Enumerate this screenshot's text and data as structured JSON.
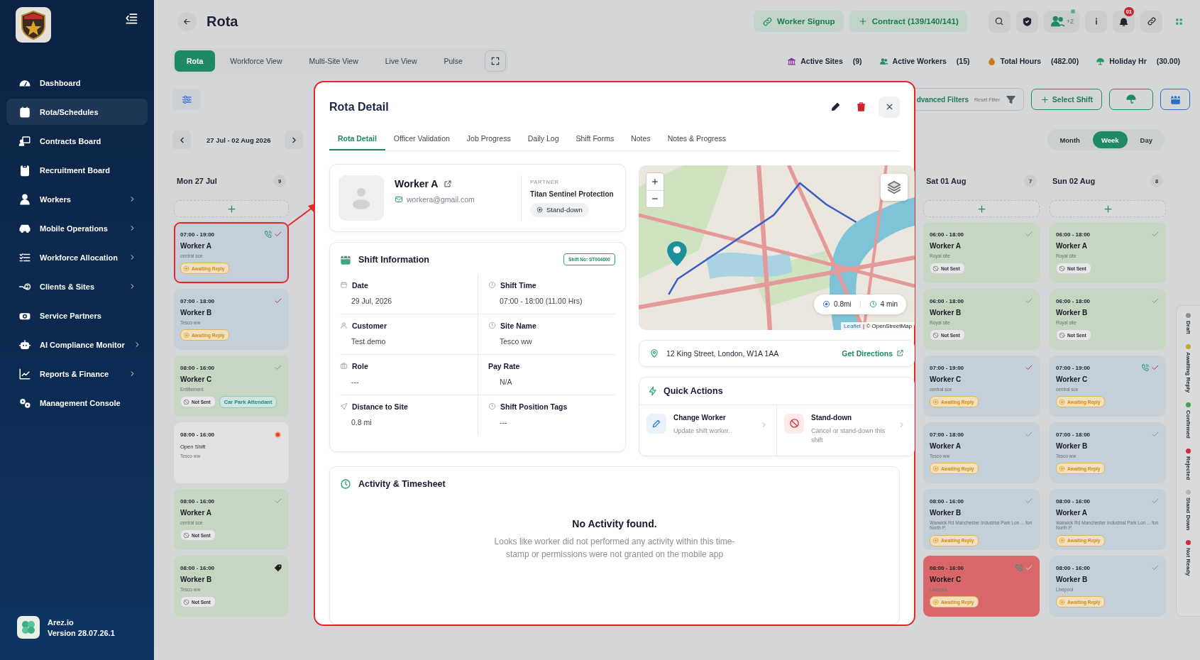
{
  "sidebar": {
    "items": [
      {
        "label": "Dashboard",
        "has_submenu": false,
        "selected": false
      },
      {
        "label": "Rota/Schedules",
        "has_submenu": false,
        "selected": true
      },
      {
        "label": "Contracts Board",
        "has_submenu": false,
        "selected": false
      },
      {
        "label": "Recruitment Board",
        "has_submenu": false,
        "selected": false
      },
      {
        "label": "Workers",
        "has_submenu": true,
        "selected": false
      },
      {
        "label": "Mobile Operations",
        "has_submenu": true,
        "selected": false
      },
      {
        "label": "Workforce Allocation",
        "has_submenu": true,
        "selected": false
      },
      {
        "label": "Clients & Sites",
        "has_submenu": true,
        "selected": false
      },
      {
        "label": "Service Partners",
        "has_submenu": false,
        "selected": false
      },
      {
        "label": "AI Compliance Monitor",
        "has_submenu": true,
        "selected": false
      },
      {
        "label": "Reports & Finance",
        "has_submenu": true,
        "selected": false
      },
      {
        "label": "Management Console",
        "has_submenu": false,
        "selected": false
      }
    ],
    "footer": {
      "name": "Arez.io",
      "version": "Version 28.07.26.1"
    }
  },
  "header": {
    "title": "Rota",
    "actions": [
      {
        "label": "Worker Signup"
      },
      {
        "label": "Contract (139/140/141)"
      }
    ],
    "avatar_more": "+2",
    "notification_count": "01"
  },
  "view_tabs": [
    {
      "label": "Rota",
      "selected": true
    },
    {
      "label": "Workforce View",
      "selected": false
    },
    {
      "label": "Multi-Site View",
      "selected": false
    },
    {
      "label": "Live View",
      "selected": false
    },
    {
      "label": "Pulse",
      "selected": false
    }
  ],
  "stats": [
    {
      "label": "Active Sites",
      "value": "(9)"
    },
    {
      "label": "Active Workers",
      "value": "(15)"
    },
    {
      "label": "Total Hours",
      "value": "(482.00)"
    },
    {
      "label": "Holiday Hr",
      "value": "(30.00)"
    }
  ],
  "filters": {
    "advanced": "dvanced Filters",
    "reset": "Reset Filter",
    "select_shift": "Select Shift"
  },
  "date_range": "27 Jul - 02 Aug 2026",
  "period_tabs": [
    {
      "label": "Month",
      "selected": false
    },
    {
      "label": "Week",
      "selected": true
    },
    {
      "label": "Day",
      "selected": false
    }
  ],
  "days": [
    {
      "title": "Mon 27 Jul",
      "count": "9",
      "shifts": [
        {
          "kind": "assigned",
          "time": "07:00 - 19:00",
          "worker": "Worker A",
          "site": "central sce",
          "status": {
            "kind": "awaiting",
            "label": "Awaiting Reply"
          },
          "color": "#c3cfd9",
          "marker": {
            "kind": "check",
            "color": "#d6285a"
          },
          "phone": true,
          "highlighted": true
        },
        {
          "kind": "assigned",
          "time": "07:00 - 18:00",
          "worker": "Worker B",
          "site": "Tesco ww",
          "status": {
            "kind": "awaiting",
            "label": "Awaiting Reply"
          },
          "color": "#c3cfd9",
          "marker": {
            "kind": "check",
            "color": "#d6285a"
          },
          "phone": false,
          "highlighted": false
        },
        {
          "kind": "assigned",
          "time": "08:00 - 16:00",
          "worker": "Worker C",
          "site": "Entitlement",
          "status": {
            "kind": "not_sent",
            "label": "Not Sent"
          },
          "tag": "Car Park Attendant",
          "color": "#c7d6c3",
          "marker": {
            "kind": "check",
            "color": "#8c9490"
          },
          "phone": false,
          "highlighted": false
        },
        {
          "kind": "open",
          "time": "08:00 - 16:00",
          "worker": "Open Shift",
          "site": "Tesco ww",
          "color": "#e2e2e2",
          "marker": {
            "kind": "dot",
            "color": "#e0452a"
          },
          "phone": false,
          "highlighted": false
        },
        {
          "kind": "assigned",
          "time": "08:00 - 16:00",
          "worker": "Worker A",
          "site": "central sce",
          "status": {
            "kind": "not_sent",
            "label": "Not Sent"
          },
          "color": "#c7d6c3",
          "marker": {
            "kind": "check",
            "color": "#8c9490"
          },
          "phone": false,
          "highlighted": false
        },
        {
          "kind": "assigned",
          "time": "08:00 - 16:00",
          "worker": "Worker B",
          "site": "Tesco ww",
          "status": {
            "kind": "not_sent",
            "label": "Not Sent"
          },
          "color": "#c7d6c3",
          "marker": {
            "kind": "tag",
            "color": "#1c1c1c"
          },
          "phone": false,
          "highlighted": false
        }
      ]
    },
    {
      "title": "Sat 01 Aug",
      "count": "7",
      "shifts": [
        {
          "kind": "assigned",
          "time": "06:00 - 18:00",
          "worker": "Worker A",
          "site": "Royal site",
          "status": {
            "kind": "not_sent",
            "label": "Not Sent"
          },
          "color": "#c7d6c3",
          "marker": {
            "kind": "check",
            "color": "#8c9490"
          },
          "phone": false,
          "highlighted": false
        },
        {
          "kind": "assigned",
          "time": "06:00 - 18:00",
          "worker": "Worker B",
          "site": "Royal site",
          "status": {
            "kind": "not_sent",
            "label": "Not Sent"
          },
          "color": "#c7d6c3",
          "marker": {
            "kind": "check",
            "color": "#8c9490"
          },
          "phone": false,
          "highlighted": false
        },
        {
          "kind": "assigned",
          "time": "07:00 - 19:00",
          "worker": "Worker C",
          "site": "central sce",
          "status": {
            "kind": "awaiting",
            "label": "Awaiting Reply"
          },
          "color": "#c3cfd9",
          "marker": {
            "kind": "check",
            "color": "#d6285a"
          },
          "phone": false,
          "highlighted": false
        },
        {
          "kind": "assigned",
          "time": "07:00 - 18:00",
          "worker": "Worker A",
          "site": "Tesco ww",
          "status": {
            "kind": "awaiting",
            "label": "Awaiting Reply"
          },
          "color": "#c3cfd9",
          "marker": {
            "kind": "check",
            "color": "#8c9490"
          },
          "phone": false,
          "highlighted": false
        },
        {
          "kind": "assigned",
          "time": "08:00 - 16:00",
          "worker": "Worker B",
          "site": "Warwick Rd Manchester Industrial Park Lon ... fon North P.",
          "status": {
            "kind": "awaiting",
            "label": "Awaiting Reply"
          },
          "color": "#c3cfd9",
          "marker": {
            "kind": "check",
            "color": "#8c9490"
          },
          "phone": false,
          "highlighted": false
        },
        {
          "kind": "assigned",
          "time": "08:00 - 16:00",
          "worker": "Worker C",
          "site": "Livepool",
          "status": {
            "kind": "awaiting",
            "label": "Awaiting Reply"
          },
          "color": "#d9676a",
          "marker": {
            "kind": "check",
            "color": "#c9d7ee"
          },
          "phone": true,
          "highlighted": false
        }
      ]
    },
    {
      "title": "Sun 02 Aug",
      "count": "8",
      "shifts": [
        {
          "kind": "assigned",
          "time": "06:00 - 18:00",
          "worker": "Worker A",
          "site": "Royal site",
          "status": {
            "kind": "not_sent",
            "label": "Not Sent"
          },
          "color": "#c7d6c3",
          "marker": {
            "kind": "check",
            "color": "#8c9490"
          },
          "phone": false,
          "highlighted": false
        },
        {
          "kind": "assigned",
          "time": "06:00 - 18:00",
          "worker": "Worker B",
          "site": "Royal site",
          "status": {
            "kind": "not_sent",
            "label": "Not Sent"
          },
          "color": "#c7d6c3",
          "marker": {
            "kind": "check",
            "color": "#8c9490"
          },
          "phone": false,
          "highlighted": false
        },
        {
          "kind": "assigned",
          "time": "07:00 - 19:00",
          "worker": "Worker C",
          "site": "central sce",
          "status": {
            "kind": "awaiting",
            "label": "Awaiting Reply"
          },
          "color": "#c3cfd9",
          "marker": {
            "kind": "check",
            "color": "#d6285a"
          },
          "phone": true,
          "highlighted": false
        },
        {
          "kind": "assigned",
          "time": "07:00 - 18:00",
          "worker": "Worker B",
          "site": "Tesco ww",
          "status": {
            "kind": "awaiting",
            "label": "Awaiting Reply"
          },
          "color": "#c3cfd9",
          "marker": {
            "kind": "check",
            "color": "#8c9490"
          },
          "phone": false,
          "highlighted": false
        },
        {
          "kind": "assigned",
          "time": "08:00 - 16:00",
          "worker": "Worker A",
          "site": "Warwick Rd Manchester Industrial Park Lon ... fon North P.",
          "status": {
            "kind": "awaiting",
            "label": "Awaiting Reply"
          },
          "color": "#c3cfd9",
          "marker": {
            "kind": "check",
            "color": "#8c9490"
          },
          "phone": false,
          "highlighted": false
        },
        {
          "kind": "assigned",
          "time": "08:00 - 16:00",
          "worker": "Worker B",
          "site": "Livepool",
          "status": {
            "kind": "awaiting",
            "label": "Awaiting Reply"
          },
          "color": "#c3cfd9",
          "marker": {
            "kind": "check",
            "color": "#8c9490"
          },
          "phone": false,
          "highlighted": false
        }
      ]
    }
  ],
  "legend": [
    {
      "label": "Draft",
      "color": "#8e8e8e"
    },
    {
      "label": "Awaiting Reply",
      "color": "#c9a23a"
    },
    {
      "label": "Confirmed",
      "color": "#3fa34d"
    },
    {
      "label": "Rejected",
      "color": "#d8283a"
    },
    {
      "label": "Stand Down",
      "color": "#b5b5b5"
    },
    {
      "label": "Not Ready",
      "color": "#d8283a"
    }
  ],
  "modal": {
    "title": "Rota Detail",
    "tabs": [
      {
        "label": "Rota Detail",
        "selected": true
      },
      {
        "label": "Officer Validation",
        "selected": false
      },
      {
        "label": "Job Progress",
        "selected": false
      },
      {
        "label": "Daily Log",
        "selected": false
      },
      {
        "label": "Shift Forms",
        "selected": false
      },
      {
        "label": "Notes",
        "selected": false
      },
      {
        "label": "Notes & Progress",
        "selected": false
      }
    ],
    "worker": {
      "name": "Worker A",
      "email": "workera@gmail.com",
      "partner_label": "PARTNER",
      "partner": "Titan Sentinel Protection",
      "status": "Stand-down"
    },
    "shift_info": {
      "title": "Shift Information",
      "shift_no": "Shift No: ST004600",
      "fields": [
        {
          "label": "Date",
          "value": "29 Jul, 2026"
        },
        {
          "label": "Shift Time",
          "value": "07:00 - 18:00 (11.00 Hrs)"
        },
        {
          "label": "Customer",
          "value": "Test demo"
        },
        {
          "label": "Site Name",
          "value": "Tesco ww"
        },
        {
          "label": "Role",
          "value": "---"
        },
        {
          "label": "Pay Rate",
          "value": "N/A"
        },
        {
          "label": "Distance to Site",
          "value": "0.8 mi"
        },
        {
          "label": "Shift Position Tags",
          "value": "---"
        }
      ]
    },
    "map": {
      "kind": "picture",
      "distance": "0.8mi",
      "duration": "4 min",
      "attribution_link": "Leaflet",
      "attribution": "| © OpenStreetMap"
    },
    "address": {
      "text": "12 King Street, London, W1A 1AA",
      "link": "Get Directions"
    },
    "quick_actions": {
      "title": "Quick Actions",
      "items": [
        {
          "kind": "change",
          "title": "Change Worker",
          "subtitle": "Update shift worker."
        },
        {
          "kind": "stand_down",
          "title": "Stand-down",
          "subtitle": "Cancel or stand-down this shift"
        }
      ]
    },
    "activity": {
      "title": "Activity & Timesheet",
      "empty_title": "No Activity found.",
      "empty_text": "Looks like worker did not performed any activity within this time-stamp or permissions were not granted on the mobile app"
    }
  }
}
